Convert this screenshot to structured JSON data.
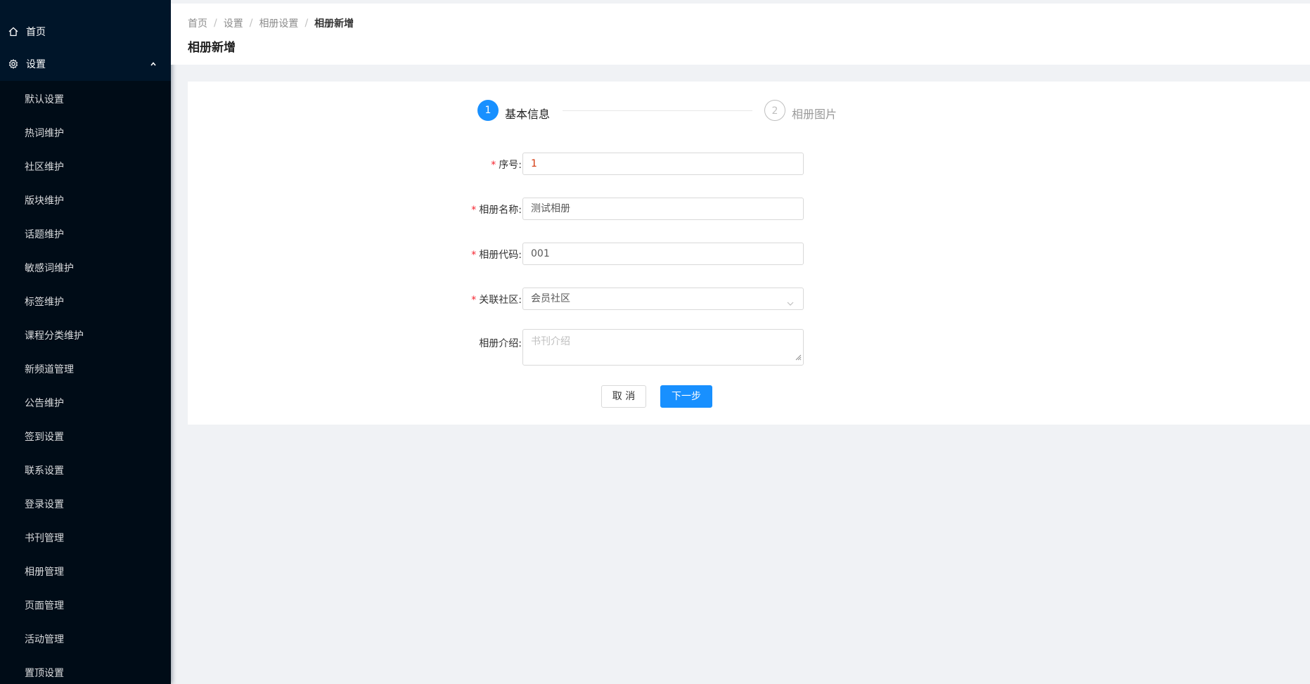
{
  "sidebar": {
    "home_label": "首页",
    "group_label": "设置",
    "items": [
      {
        "label": "默认设置"
      },
      {
        "label": "热词维护"
      },
      {
        "label": "社区维护"
      },
      {
        "label": "版块维护"
      },
      {
        "label": "话题维护"
      },
      {
        "label": "敏感词维护"
      },
      {
        "label": "标签维护"
      },
      {
        "label": "课程分类维护"
      },
      {
        "label": "新频道管理"
      },
      {
        "label": "公告维护"
      },
      {
        "label": "签到设置"
      },
      {
        "label": "联系设置"
      },
      {
        "label": "登录设置"
      },
      {
        "label": "书刊管理"
      },
      {
        "label": "相册管理"
      },
      {
        "label": "页面管理"
      },
      {
        "label": "活动管理"
      },
      {
        "label": "置顶设置"
      }
    ]
  },
  "header": {
    "breadcrumb": [
      "首页",
      "设置",
      "相册设置",
      "相册新增"
    ],
    "separator": "/",
    "title": "相册新增"
  },
  "steps": [
    {
      "number": "1",
      "label": "基本信息"
    },
    {
      "number": "2",
      "label": "相册图片"
    }
  ],
  "form": {
    "required_mark": "*",
    "seq": {
      "label": "序号:",
      "value": "1"
    },
    "name": {
      "label": "相册名称:",
      "value": "测试相册"
    },
    "code": {
      "label": "相册代码:",
      "value": "001"
    },
    "community": {
      "label": "关联社区:",
      "value": "会员社区"
    },
    "intro": {
      "label": "相册介绍:",
      "placeholder": "书刊介绍"
    }
  },
  "buttons": {
    "cancel": "取 消",
    "next": "下一步"
  },
  "colors": {
    "primary": "#1890ff",
    "sidebar_bg": "#001529",
    "submenu_bg": "#000c17",
    "required": "#f5222d"
  }
}
